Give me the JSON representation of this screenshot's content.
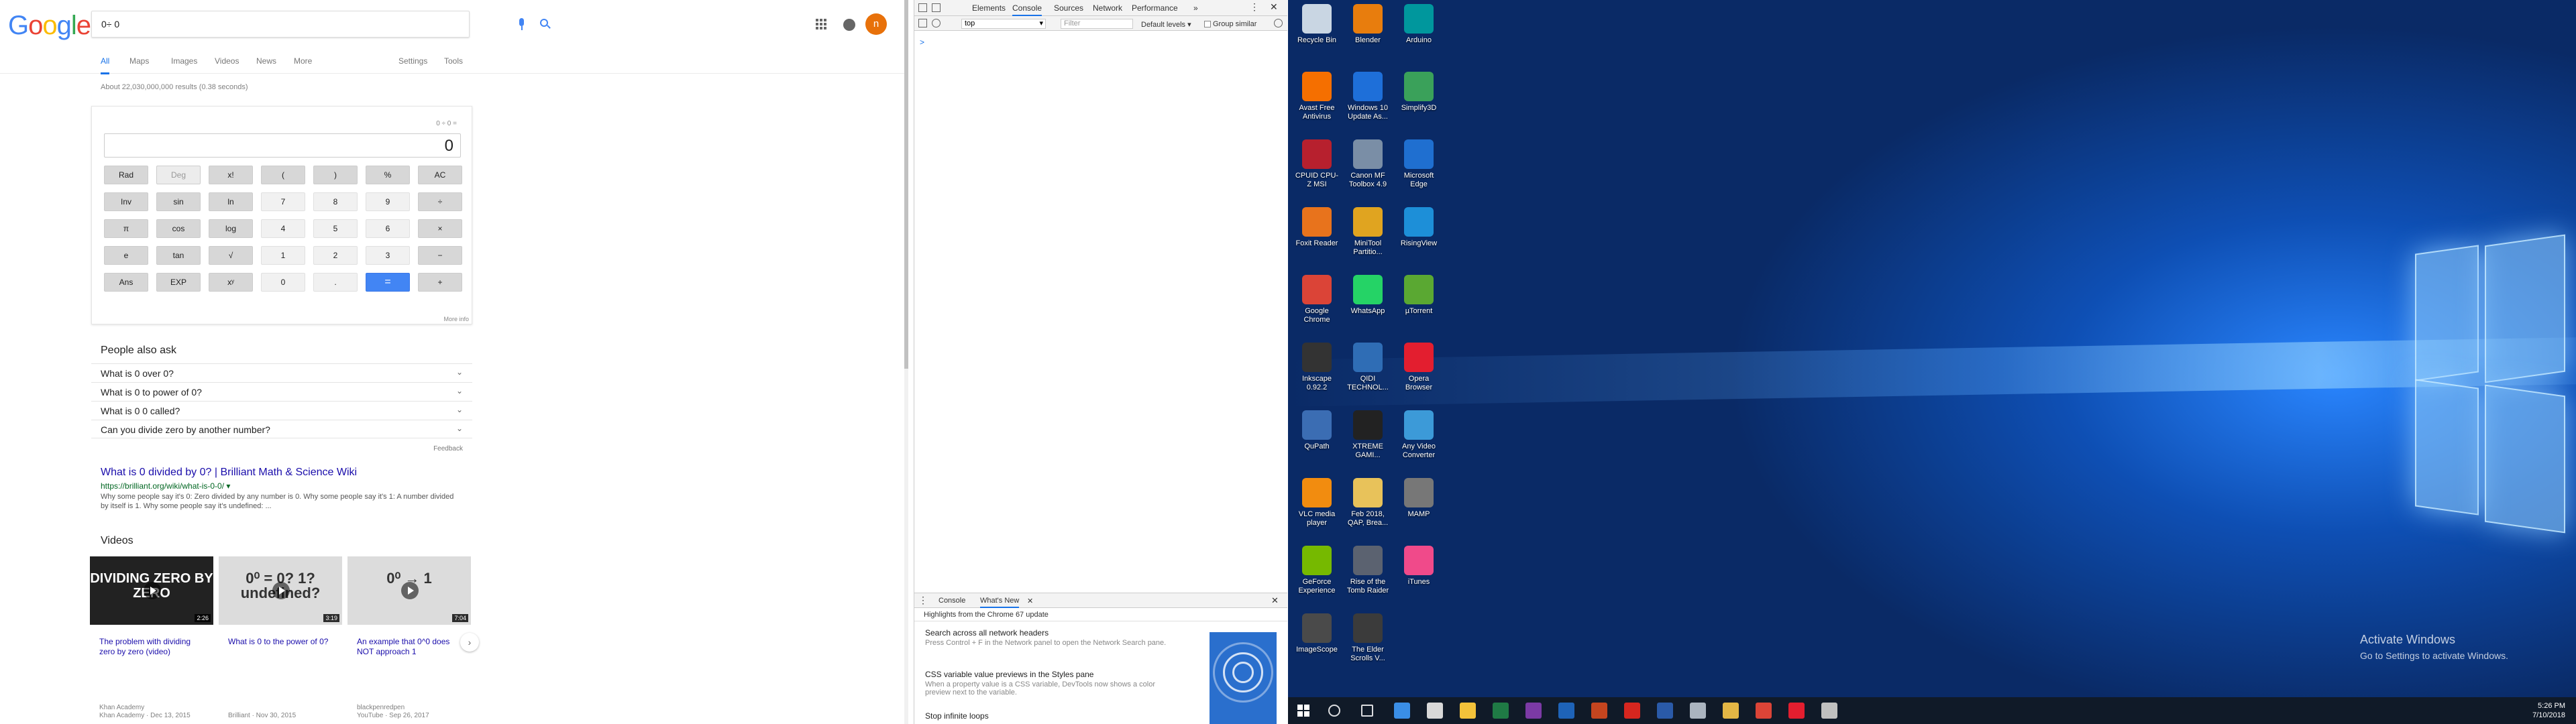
{
  "google": {
    "logo": [
      "G",
      "o",
      "o",
      "g",
      "l",
      "e"
    ],
    "query": "0÷ 0",
    "avatar_letter": "n",
    "tabs": [
      "All",
      "Maps",
      "Images",
      "Videos",
      "News",
      "More",
      "Settings",
      "Tools"
    ],
    "stats": "About 22,030,000,000 results (0.38 seconds)",
    "calculator": {
      "history": "0 ÷ 0 =",
      "display": "0",
      "keys": [
        [
          "Rad",
          "Deg",
          "x!",
          "(",
          ")",
          "%",
          "AC"
        ],
        [
          "Inv",
          "sin",
          "ln",
          "7",
          "8",
          "9",
          "÷"
        ],
        [
          "π",
          "cos",
          "log",
          "4",
          "5",
          "6",
          "×"
        ],
        [
          "e",
          "tan",
          "√",
          "1",
          "2",
          "3",
          "−"
        ],
        [
          "Ans",
          "EXP",
          "xʸ",
          "0",
          ".",
          "=",
          "+"
        ]
      ],
      "more_info": "More info"
    },
    "people_also_ask": {
      "heading": "People also ask",
      "questions": [
        "What is 0 over 0?",
        "What is 0 to power of 0?",
        "What is 0 0 called?",
        "Can you divide zero by another number?"
      ],
      "feedback": "Feedback"
    },
    "result": {
      "title": "What is 0 divided by 0? | Brilliant Math & Science Wiki",
      "url": "https://brilliant.org/wiki/what-is-0-0/ ▾",
      "snippet": "Why some people say it's 0: Zero divided by any number is 0. Why some people say it's 1: A number divided by itself is 1. Why some people say it's undefined: ..."
    },
    "videos": {
      "heading": "Videos",
      "items": [
        {
          "thumb_text": "DIVIDING ZERO BY ZERO",
          "duration": "2:26",
          "title": "The problem with dividing zero by zero (video)",
          "source": "Khan Academy",
          "meta": "Khan Academy · Dec 13, 2015"
        },
        {
          "thumb_text": "0⁰ = 0? 1? undefined?",
          "duration": "3:19",
          "title": "What is 0 to the power of 0?",
          "source": "",
          "meta": "Brilliant · Nov 30, 2015"
        },
        {
          "thumb_text": "0⁰ → 1",
          "duration": "7:04",
          "title": "An example that 0^0 does NOT approach 1",
          "source": "blackpenredpen",
          "meta": "YouTube · Sep 26, 2017"
        }
      ],
      "next_icon": "›"
    }
  },
  "devtools": {
    "tabs": [
      "Elements",
      "Console",
      "Sources",
      "Network",
      "Performance",
      "»"
    ],
    "active_tab": "Console",
    "context": "top",
    "filter_placeholder": "Filter",
    "levels": "Default levels ▾",
    "group_similar": "Group similar",
    "prompt": ">",
    "drawer_tabs": [
      "Console",
      "What's New"
    ],
    "whats_new": {
      "header": "Highlights from the Chrome 67 update",
      "items": [
        {
          "title": "Search across all network headers",
          "desc": "Press Control + F in the Network panel to open the Network Search pane."
        },
        {
          "title": "CSS variable value previews in the Styles pane",
          "desc": "When a property value is a CSS variable, DevTools now shows a color preview next to the variable."
        },
        {
          "title": "Stop infinite loops",
          "desc": ""
        }
      ]
    }
  },
  "desktop": {
    "icons": [
      {
        "label": "Recycle Bin",
        "color": "#c9d6e3"
      },
      {
        "label": "Blender",
        "color": "#e87d0d"
      },
      {
        "label": "Arduino",
        "color": "#00979d"
      },
      {
        "label": "Avast Free Antivirus",
        "color": "#f56f00"
      },
      {
        "label": "Windows 10 Update As...",
        "color": "#1e6fd9"
      },
      {
        "label": "Simplify3D",
        "color": "#3aa15a"
      },
      {
        "label": "CPUID CPU-Z MSI",
        "color": "#b7202e"
      },
      {
        "label": "Canon MF Toolbox 4.9",
        "color": "#7a8ea6"
      },
      {
        "label": "Microsoft Edge",
        "color": "#1f6fd0"
      },
      {
        "label": "Foxit Reader",
        "color": "#e8731c"
      },
      {
        "label": "MiniTool Partitio...",
        "color": "#e0a420"
      },
      {
        "label": "RisingView",
        "color": "#1d8fd8"
      },
      {
        "label": "Google Chrome",
        "color": "#db4437"
      },
      {
        "label": "WhatsApp",
        "color": "#25d366"
      },
      {
        "label": "µTorrent",
        "color": "#5aa832"
      },
      {
        "label": "Inkscape 0.92.2",
        "color": "#333333"
      },
      {
        "label": "QIDI TECHNOL...",
        "color": "#2f6db5"
      },
      {
        "label": "Opera Browser",
        "color": "#e31e2f"
      },
      {
        "label": "QuPath",
        "color": "#3b6db3"
      },
      {
        "label": "XTREME GAMI...",
        "color": "#222222"
      },
      {
        "label": "Any Video Converter",
        "color": "#3c9ad8"
      },
      {
        "label": "VLC media player",
        "color": "#f28c0f"
      },
      {
        "label": "Feb 2018, QAP, Brea...",
        "color": "#e8c25a"
      },
      {
        "label": "MAMP",
        "color": "#777777"
      },
      {
        "label": "GeForce Experience",
        "color": "#76b900"
      },
      {
        "label": "Rise of the Tomb Raider",
        "color": "#5b6270"
      },
      {
        "label": "iTunes",
        "color": "#f04a8a"
      },
      {
        "label": "ImageScope",
        "color": "#4a4a4a"
      },
      {
        "label": "The Elder Scrolls V...",
        "color": "#3b3b3b"
      }
    ],
    "activation_title": "Activate Windows",
    "activation_text": "Go to Settings to activate Windows."
  },
  "taskbar": {
    "apps": [
      {
        "name": "search-icon",
        "color": "#ffffff"
      },
      {
        "name": "task-view-icon",
        "color": "#ffffff"
      },
      {
        "name": "edge-icon",
        "color": "#3a8ee6"
      },
      {
        "name": "store-icon",
        "color": "#d8d8d8"
      },
      {
        "name": "file-explorer-icon",
        "color": "#f3c23a"
      },
      {
        "name": "excel-icon",
        "color": "#1f7a45"
      },
      {
        "name": "onenote-icon",
        "color": "#7b3aa5"
      },
      {
        "name": "outlook-icon",
        "color": "#1e63b8"
      },
      {
        "name": "powerpoint-icon",
        "color": "#c4451f"
      },
      {
        "name": "acrobat-icon",
        "color": "#d6261f"
      },
      {
        "name": "word-icon",
        "color": "#2a5aa8"
      },
      {
        "name": "media-icon",
        "color": "#aab4c0"
      },
      {
        "name": "folder-icon",
        "color": "#e3b645"
      },
      {
        "name": "chrome-icon",
        "color": "#db4437"
      },
      {
        "name": "opera-icon",
        "color": "#e31e2f"
      },
      {
        "name": "app-icon",
        "color": "#c0c0c0"
      }
    ],
    "time": "5:26 PM",
    "date": "7/10/2018"
  }
}
